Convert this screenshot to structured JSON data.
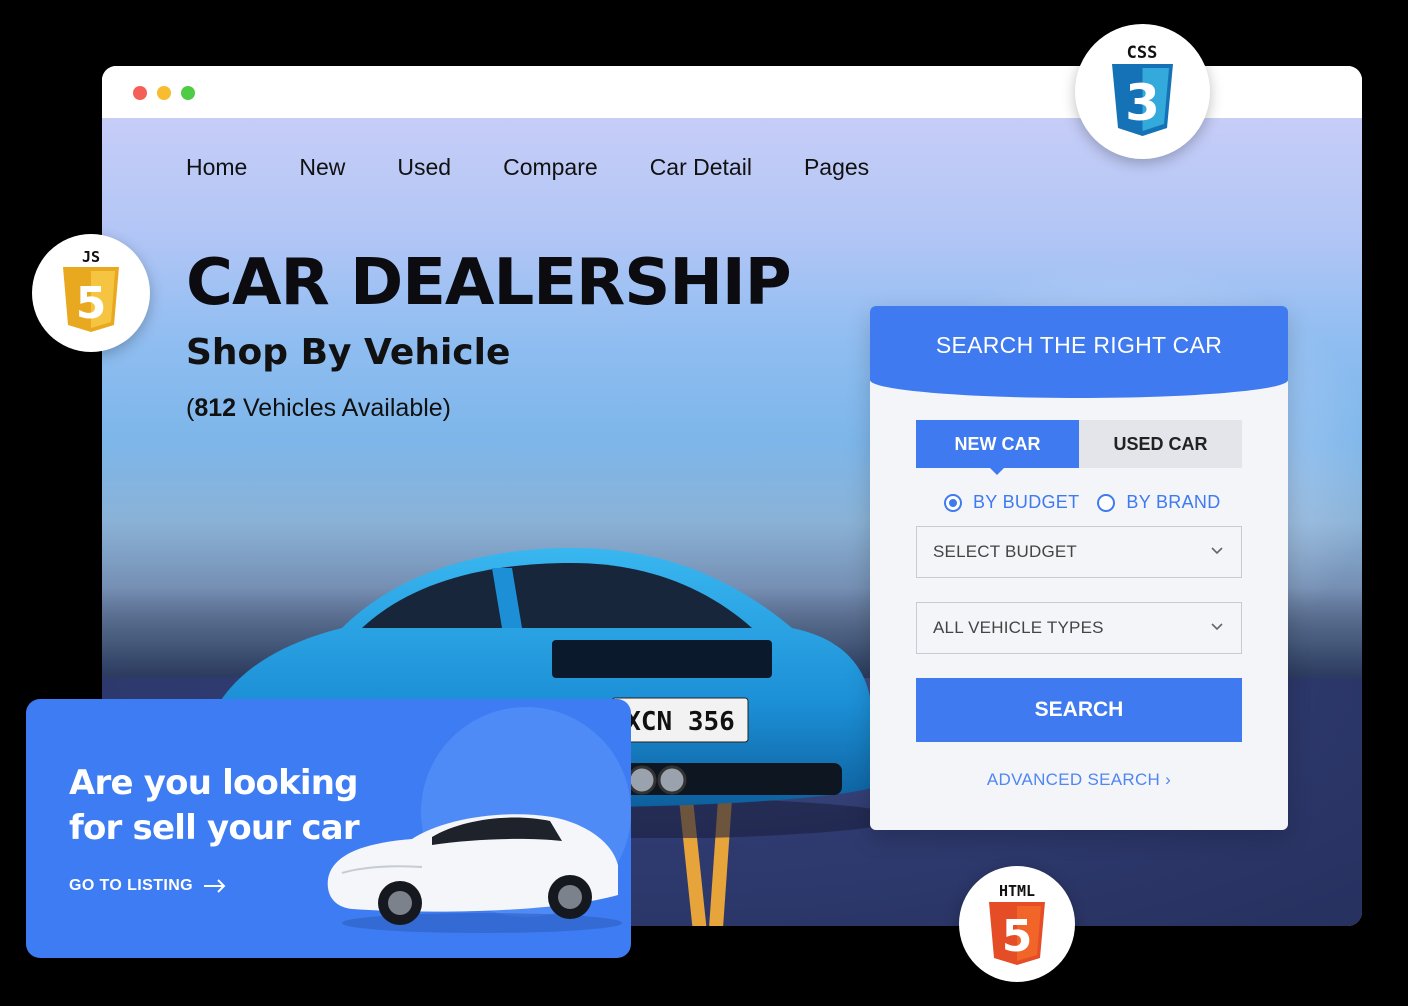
{
  "nav": {
    "items": [
      "Home",
      "New",
      "Used",
      "Compare",
      "Car Detail",
      "Pages"
    ]
  },
  "hero": {
    "headline": "CAR DEALERSHIP",
    "subheadline": "Shop By Vehicle",
    "available_open": "(",
    "available_count": "812",
    "available_label": " Vehicles Available)",
    "plate": "XCN 356"
  },
  "search_panel": {
    "title": "SEARCH THE RIGHT CAR",
    "tabs": [
      {
        "label": "NEW CAR",
        "active": true
      },
      {
        "label": "USED CAR",
        "active": false
      }
    ],
    "radios": [
      {
        "label": "BY BUDGET",
        "checked": true
      },
      {
        "label": "BY BRAND",
        "checked": false
      }
    ],
    "budget_select": "SELECT BUDGET",
    "type_select": "ALL VEHICLE TYPES",
    "search_label": "SEARCH",
    "advanced_label": "ADVANCED SEARCH ›"
  },
  "sell_card": {
    "title": "Are you looking for sell your car",
    "link_label": "GO TO LISTING"
  },
  "badges": {
    "css": "CSS",
    "css_number": "3",
    "js": "JS",
    "js_number": "5",
    "html": "HTML",
    "html_number": "5"
  },
  "colors": {
    "accent": "#3f7af0",
    "css_blue": "#1572b6",
    "js_yellow": "#f0b429",
    "html_orange": "#e44d26"
  },
  "icons": {
    "window_controls": [
      "close-dot",
      "minimize-dot",
      "maximize-dot"
    ],
    "select_chevron": "chevron-down-icon",
    "link_arrow": "arrow-right-icon"
  }
}
